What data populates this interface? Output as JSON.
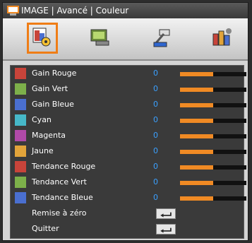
{
  "title": "IMAGE | Avancé | Couleur",
  "tabs": [
    {
      "icon": "picture-settings-icon",
      "selected": true
    },
    {
      "icon": "display-icon",
      "selected": false
    },
    {
      "icon": "setup-icon",
      "selected": false
    },
    {
      "icon": "options-icon",
      "selected": false
    }
  ],
  "rows": [
    {
      "label": "Gain Rouge",
      "value": "0",
      "color": "#c8443a",
      "level": 0.5
    },
    {
      "label": "Gain Vert",
      "value": "0",
      "color": "#7db04a",
      "level": 0.5
    },
    {
      "label": "Gain Bleue",
      "value": "0",
      "color": "#4a6fd0",
      "level": 0.5
    },
    {
      "label": "Cyan",
      "value": "0",
      "color": "#46b8c8",
      "level": 0.5
    },
    {
      "label": "Magenta",
      "value": "0",
      "color": "#b04aa8",
      "level": 0.5
    },
    {
      "label": "Jaune",
      "value": "0",
      "color": "#e2a43a",
      "level": 0.5
    },
    {
      "label": "Tendance Rouge",
      "value": "0",
      "color": "#c8443a",
      "level": 0.5
    },
    {
      "label": "Tendance Vert",
      "value": "0",
      "color": "#7db04a",
      "level": 0.5
    },
    {
      "label": "Tendance Bleue",
      "value": "0",
      "color": "#4a6fd0",
      "level": 0.5
    }
  ],
  "actions": [
    {
      "label": "Remise à zéro",
      "icon": "enter-icon"
    },
    {
      "label": "Quitter",
      "icon": "enter-icon"
    }
  ],
  "colors": {
    "accent": "#ef7d16",
    "value": "#3aa0ff",
    "bar_fill": "#f08a24"
  }
}
